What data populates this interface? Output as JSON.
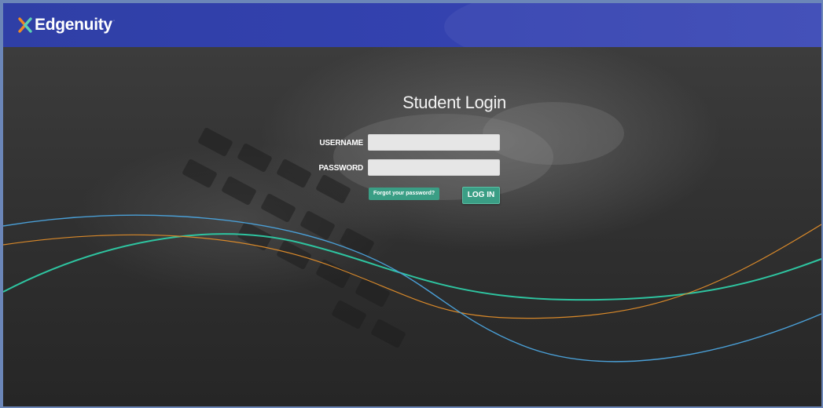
{
  "brand": {
    "name": "Edgenuity",
    "trademark": "·",
    "icon": "edgenuity-x-icon",
    "header_color": "#3442b0"
  },
  "login": {
    "title": "Student Login",
    "username_label": "USERNAME",
    "username_value": "",
    "password_label": "PASSWORD",
    "password_value": "",
    "forgot_label": "Forgot your password?",
    "submit_label": "LOG IN",
    "accent_color": "#3a9e85"
  },
  "decor": {
    "wave_colors": [
      "#2ec4a0",
      "#d9892a",
      "#4a9fd6"
    ]
  }
}
